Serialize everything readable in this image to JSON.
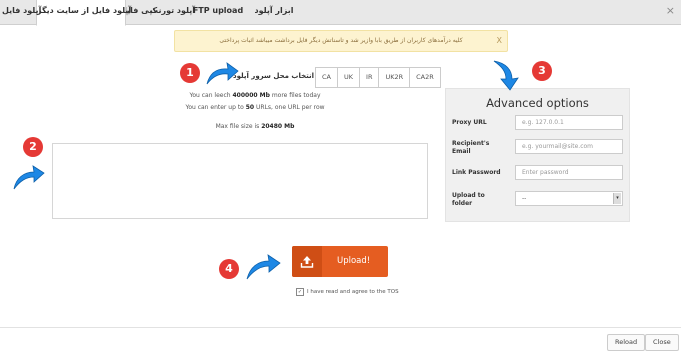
{
  "tabs": [
    {
      "label": "ابزار آپلود"
    },
    {
      "label": "FTP upload"
    },
    {
      "label": "آپلود تورنت"
    },
    {
      "label": "کپی فایل"
    },
    {
      "label": "آپلود فایل از سایت دیگر"
    },
    {
      "label": "آپلود فایل"
    }
  ],
  "close_glyph": "×",
  "banner": {
    "text": "کلیه درآمدهای کاربران از طریق بابا وازیر شد و تاسناتش دیگر فایل برداشت میباشد اثبات پرداختی",
    "close": "X"
  },
  "server": {
    "label": "انتخاب محل سرور آپلود",
    "options": [
      "CA",
      "UK",
      "IR",
      "UK2R",
      "CA2R"
    ]
  },
  "info": {
    "leech_pre": "You can leech ",
    "leech_value": "400000 Mb",
    "leech_post": " more files today",
    "urls_pre": "You can enter up to ",
    "urls_value": "50",
    "urls_post": " URLs, one URL per row",
    "max_pre": "Max file size is ",
    "max_value": "20480 Mb"
  },
  "advanced": {
    "title": "Advanced options",
    "proxy_label": "Proxy URL",
    "proxy_placeholder": "e.g. 127.0.0.1",
    "email_label": "Recipient's Email",
    "email_placeholder": "e.g. yourmail@site.com",
    "password_label": "Link Password",
    "password_placeholder": "Enter password",
    "folder_label": "Upload to folder",
    "folder_value": "--"
  },
  "upload": {
    "label": "Upload!"
  },
  "tos": {
    "text": "I have read and agree to the TOS"
  },
  "footer": {
    "reload": "Reload",
    "close": "Close"
  },
  "badges": [
    "1",
    "2",
    "3",
    "4"
  ],
  "colors": {
    "accent": "#e55d21",
    "badge": "#e53935",
    "arrow": "#1e88e5"
  }
}
